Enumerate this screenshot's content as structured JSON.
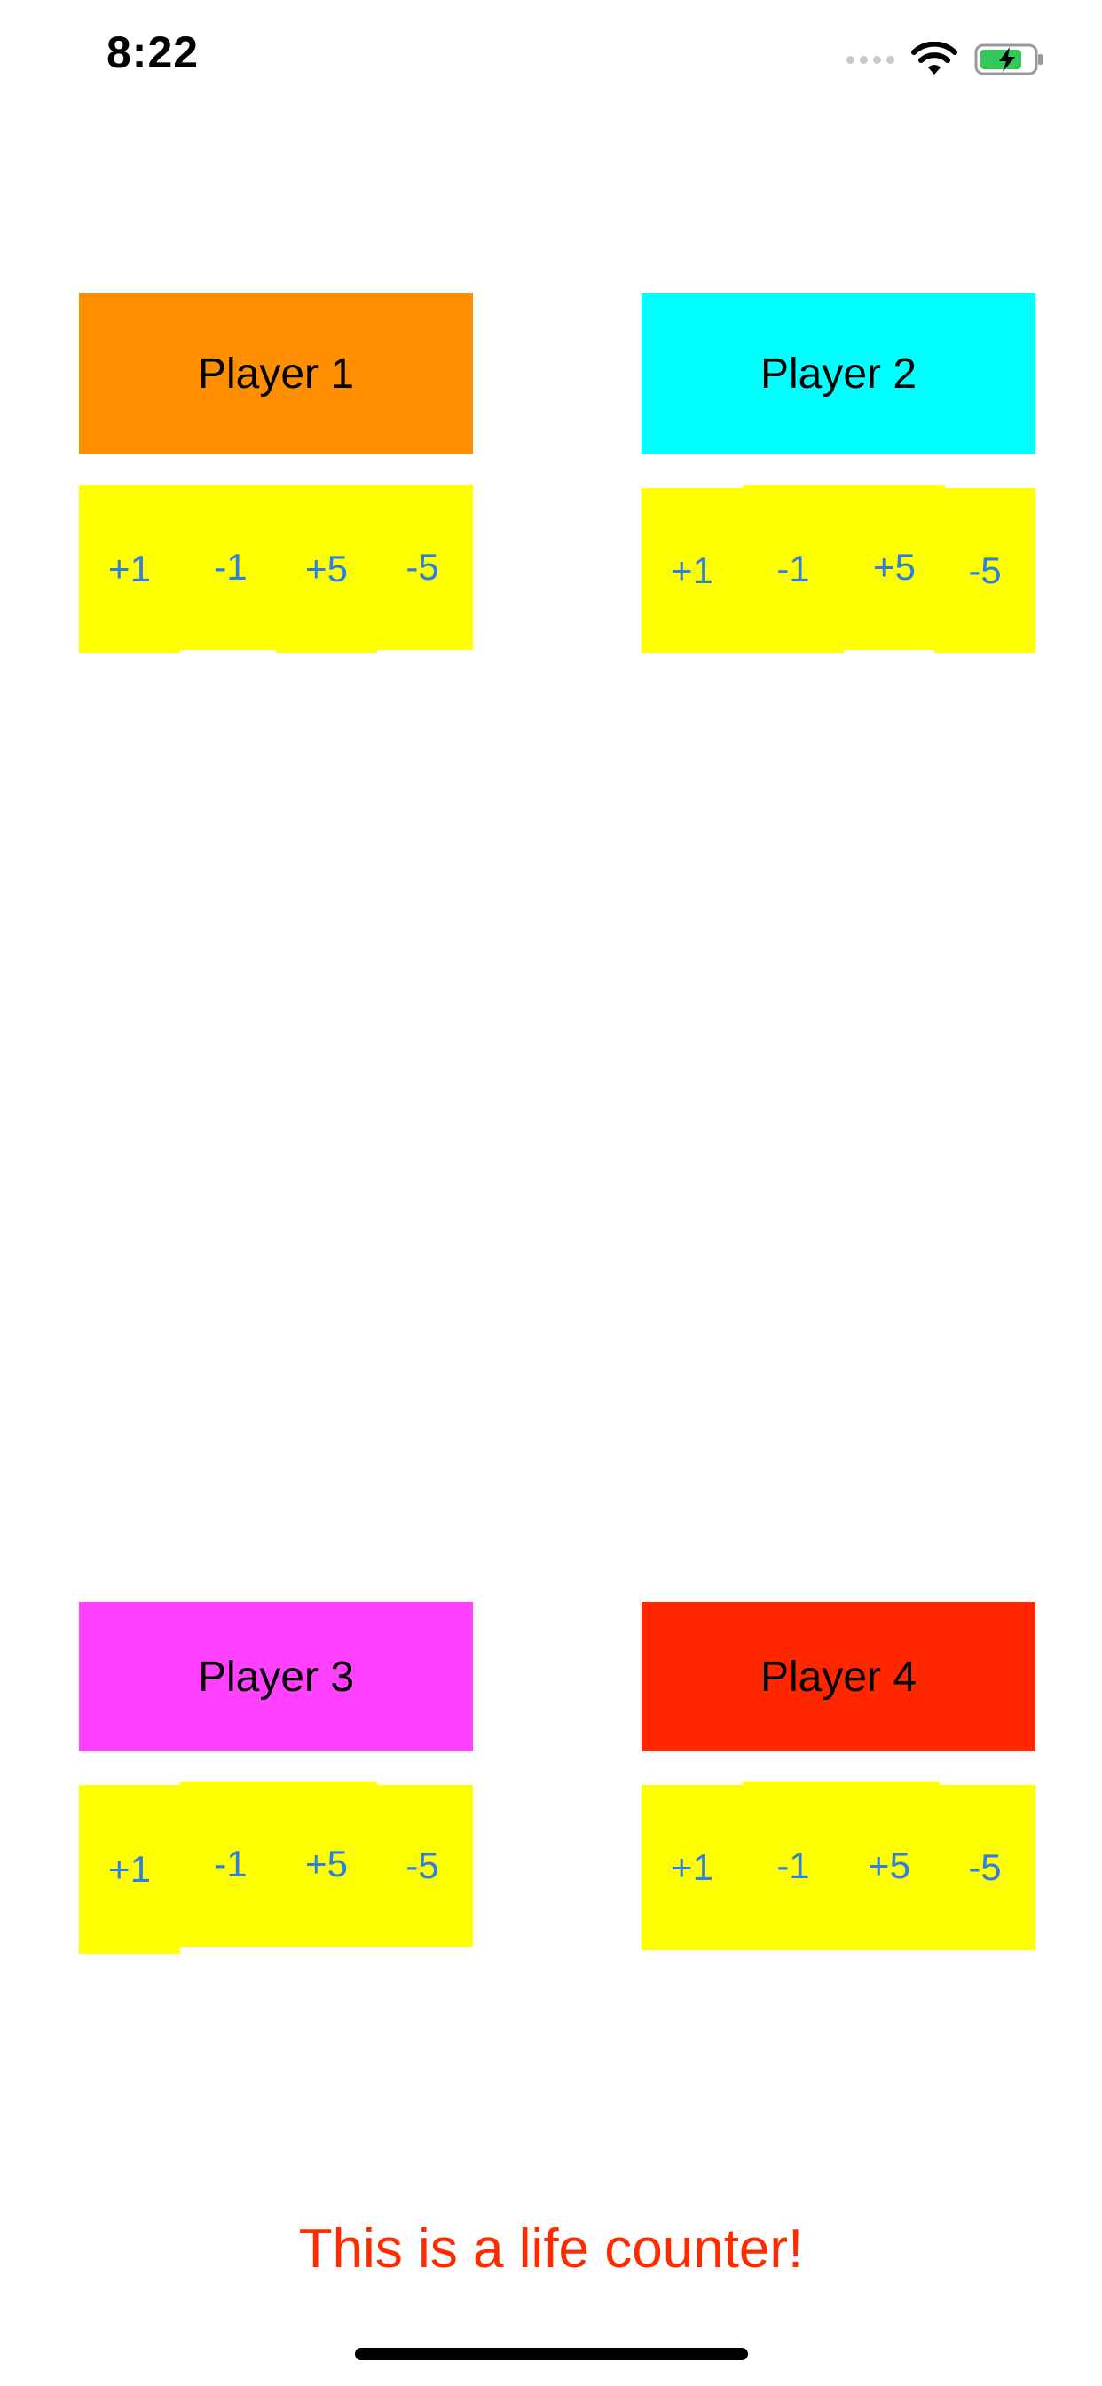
{
  "status_bar": {
    "time": "8:22",
    "icons": [
      "signal-dots-icon",
      "wifi-icon",
      "battery-charging-icon"
    ]
  },
  "players": [
    {
      "name": "Player 1",
      "color": "#ff8f00",
      "buttons": [
        "+1",
        "-1",
        "+5",
        "-5"
      ]
    },
    {
      "name": "Player 2",
      "color": "#00ffff",
      "buttons": [
        "+1",
        "-1",
        "+5",
        "-5"
      ]
    },
    {
      "name": "Player 3",
      "color": "#ff40ff",
      "buttons": [
        "+1",
        "-1",
        "+5",
        "-5"
      ]
    },
    {
      "name": "Player 4",
      "color": "#ff2600",
      "buttons": [
        "+1",
        "-1",
        "+5",
        "-5"
      ]
    }
  ],
  "controls_color": "#ffff00",
  "button_text_color": "#2f7fe0",
  "footer": {
    "text": "This is a life counter!",
    "color": "#ff2a00"
  }
}
